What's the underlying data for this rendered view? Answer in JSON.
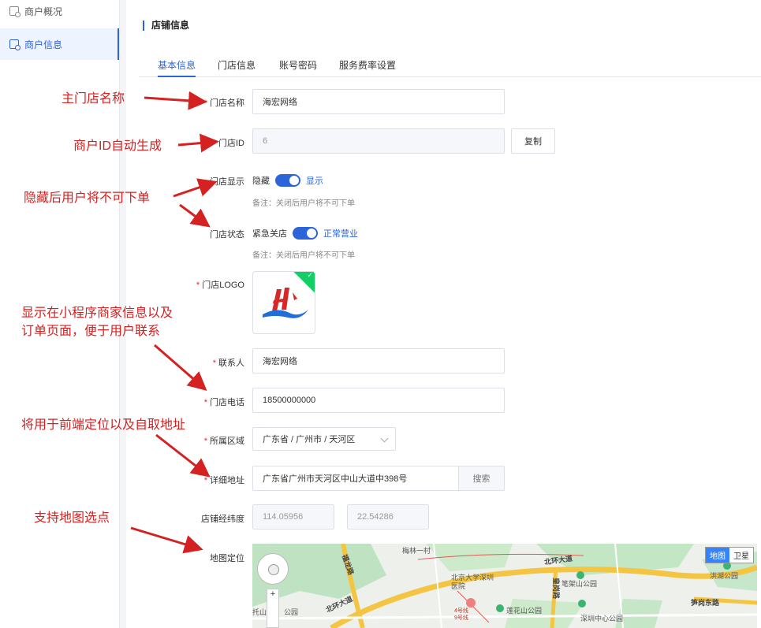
{
  "sidebar": {
    "items": [
      {
        "label": "商户概况",
        "active": false
      },
      {
        "label": "商户信息",
        "active": true
      }
    ]
  },
  "page": {
    "section_title": "店铺信息",
    "tabs": [
      "基本信息",
      "门店信息",
      "账号密码",
      "服务费率设置"
    ]
  },
  "form": {
    "store_name": {
      "label": "门店名称",
      "value": "海宏网络"
    },
    "store_id": {
      "label": "门店ID",
      "value": "6",
      "copy_label": "复制"
    },
    "store_display": {
      "label": "门店显示",
      "off_text": "隐藏",
      "on_text": "显示",
      "note": "备注：关闭后用户将不可下单"
    },
    "store_status": {
      "label": "门店状态",
      "off_text": "紧急关店",
      "on_text": "正常营业",
      "note": "备注：关闭后用户将不可下单"
    },
    "store_logo": {
      "label": "门店LOGO"
    },
    "contact": {
      "label": "联系人",
      "value": "海宏网络"
    },
    "phone": {
      "label": "门店电话",
      "value": "18500000000"
    },
    "region": {
      "label": "所属区域",
      "value": "广东省 / 广州市 / 天河区"
    },
    "address": {
      "label": "详细地址",
      "value": "广东省广州市天河区中山大道中398号",
      "search_label": "搜索"
    },
    "coords": {
      "label": "店铺经纬度",
      "lng": "114.05956",
      "lat": "22.54286"
    },
    "map": {
      "label": "地图定位"
    }
  },
  "map": {
    "type_map": "地图",
    "type_sat": "卫星",
    "zoom_plus": "+",
    "labels": [
      "梅林一村",
      "福龙路",
      "北环大道",
      "北京大学深圳医院",
      "皇岗路",
      "笔架山公园",
      "洪湖公园",
      "北环大道",
      "莲花山公园",
      "深圳中心公园",
      "笋岗东路",
      "托山",
      "公园",
      "4号线",
      "9号线"
    ]
  },
  "annotations": [
    "主门店名称",
    "商户ID自动生成",
    "隐藏后用户将不可下单",
    "显示在小程序商家信息以及",
    "订单页面，便于用户联系",
    "将用于前端定位以及自取地址",
    "支持地图选点"
  ],
  "colors": {
    "accent": "#2b65d9",
    "annotation": "#d42121",
    "success": "#13ce66"
  }
}
